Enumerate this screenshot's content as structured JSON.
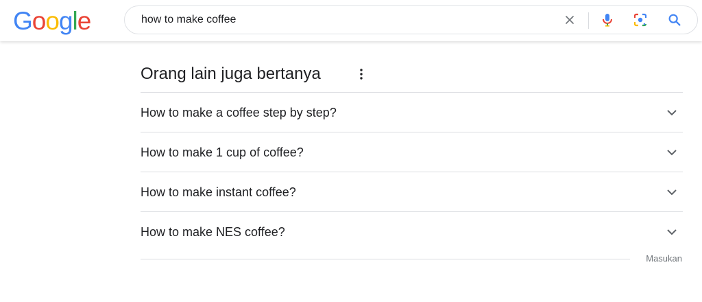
{
  "header": {
    "logo": {
      "letters": [
        "G",
        "o",
        "o",
        "g",
        "l",
        "e"
      ],
      "colors": [
        "#4285F4",
        "#EA4335",
        "#FBBC05",
        "#4285F4",
        "#34A853",
        "#EA4335"
      ]
    },
    "search": {
      "value": "how to make coffee"
    },
    "icons": {
      "clear": "close-icon",
      "voice": "microphone-icon",
      "image": "lens-icon",
      "search": "search-icon"
    }
  },
  "paa": {
    "title": "Orang lain juga bertanya",
    "menu_icon": "more-vert-icon",
    "questions": [
      "How to make a coffee step by step?",
      "How to make 1 cup of coffee?",
      "How to make instant coffee?",
      "How to make NES coffee?"
    ],
    "feedback_label": "Masukan"
  },
  "colors": {
    "text": "#202124",
    "divider": "#dadce0",
    "muted": "#70757a",
    "accent_blue": "#4285F4"
  }
}
